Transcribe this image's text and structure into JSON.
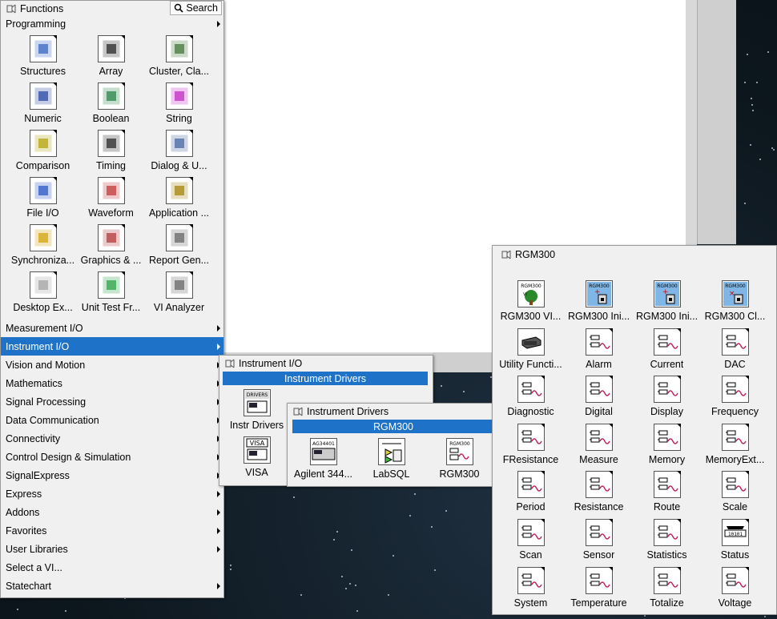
{
  "functions_palette": {
    "title": "Functions",
    "search_label": "Search",
    "category": "Programming",
    "icons": [
      {
        "label": "Structures",
        "icon": "structures-icon",
        "color": "#3060c0"
      },
      {
        "label": "Array",
        "icon": "array-icon",
        "color": "#202020"
      },
      {
        "label": "Cluster, Cla...",
        "icon": "cluster-icon",
        "color": "#3a7030"
      },
      {
        "label": "Numeric",
        "icon": "numeric-icon",
        "color": "#2040a0"
      },
      {
        "label": "Boolean",
        "icon": "boolean-icon",
        "color": "#208040"
      },
      {
        "label": "String",
        "icon": "string-icon",
        "color": "#c020c0"
      },
      {
        "label": "Comparison",
        "icon": "comparison-icon",
        "color": "#b0a000"
      },
      {
        "label": "Timing",
        "icon": "timing-icon",
        "color": "#202020"
      },
      {
        "label": "Dialog & U...",
        "icon": "dialog-icon",
        "color": "#4060a0"
      },
      {
        "label": "File I/O",
        "icon": "file-io-icon",
        "color": "#2050c0"
      },
      {
        "label": "Waveform",
        "icon": "waveform-icon",
        "color": "#c03030"
      },
      {
        "label": "Application ...",
        "icon": "application-icon",
        "color": "#a08000"
      },
      {
        "label": "Synchroniza...",
        "icon": "synchronization-icon",
        "color": "#d0a000"
      },
      {
        "label": "Graphics & ...",
        "icon": "graphics-icon",
        "color": "#b03030"
      },
      {
        "label": "Report Gen...",
        "icon": "report-icon",
        "color": "#606060"
      },
      {
        "label": "Desktop Ex...",
        "icon": "desktop-execution-icon",
        "color": "#a0a0a0"
      },
      {
        "label": "Unit Test Fr...",
        "icon": "unit-test-icon",
        "color": "#20a040"
      },
      {
        "label": "VI Analyzer",
        "icon": "vi-analyzer-icon",
        "color": "#606060"
      }
    ],
    "menu_items": [
      "Measurement I/O",
      "Instrument I/O",
      "Vision and Motion",
      "Mathematics",
      "Signal Processing",
      "Data Communication",
      "Connectivity",
      "Control Design & Simulation",
      "SignalExpress",
      "Express",
      "Addons",
      "Favorites",
      "User Libraries",
      "Select a VI...",
      "Statechart"
    ],
    "selected_menu": "Instrument I/O"
  },
  "instrument_io_palette": {
    "title": "Instrument I/O",
    "highlight": "Instrument Drivers",
    "icons": [
      {
        "label": "Instr Drivers",
        "icon": "instr-drivers-icon"
      },
      {
        "label": "VISA",
        "icon": "visa-icon"
      }
    ]
  },
  "instrument_drivers_palette": {
    "title": "Instrument Drivers",
    "highlight": "RGM300",
    "icons": [
      {
        "label": "Agilent 344...",
        "icon": "agilent-icon"
      },
      {
        "label": "LabSQL",
        "icon": "labsql-icon"
      },
      {
        "label": "RGM300",
        "icon": "rgm300-icon"
      }
    ]
  },
  "rgm300_palette": {
    "title": "RGM300",
    "icons": [
      {
        "label": "RGM300 VI...",
        "icon": "vi-tree-icon"
      },
      {
        "label": "RGM300 Ini...",
        "icon": "initialize-icon"
      },
      {
        "label": "RGM300 Ini...",
        "icon": "initialize-2-icon"
      },
      {
        "label": "RGM300 Cl...",
        "icon": "close-icon"
      },
      {
        "label": "Utility Functi...",
        "icon": "utility-icon"
      },
      {
        "label": "Alarm",
        "icon": "subpalette-icon"
      },
      {
        "label": "Current",
        "icon": "subpalette-icon"
      },
      {
        "label": "DAC",
        "icon": "subpalette-icon"
      },
      {
        "label": "Diagnostic",
        "icon": "subpalette-icon"
      },
      {
        "label": "Digital",
        "icon": "subpalette-icon"
      },
      {
        "label": "Display",
        "icon": "subpalette-icon"
      },
      {
        "label": "Frequency",
        "icon": "subpalette-icon"
      },
      {
        "label": "FResistance",
        "icon": "subpalette-icon"
      },
      {
        "label": "Measure",
        "icon": "subpalette-icon"
      },
      {
        "label": "Memory",
        "icon": "subpalette-icon"
      },
      {
        "label": "MemoryExt...",
        "icon": "subpalette-icon"
      },
      {
        "label": "Period",
        "icon": "subpalette-icon"
      },
      {
        "label": "Resistance",
        "icon": "subpalette-icon"
      },
      {
        "label": "Route",
        "icon": "subpalette-icon"
      },
      {
        "label": "Scale",
        "icon": "subpalette-icon"
      },
      {
        "label": "Scan",
        "icon": "subpalette-icon"
      },
      {
        "label": "Sensor",
        "icon": "subpalette-icon"
      },
      {
        "label": "Statistics",
        "icon": "subpalette-icon"
      },
      {
        "label": "Status",
        "icon": "status-icon"
      },
      {
        "label": "System",
        "icon": "subpalette-icon"
      },
      {
        "label": "Temperature",
        "icon": "subpalette-icon"
      },
      {
        "label": "Totalize",
        "icon": "subpalette-icon"
      },
      {
        "label": "Voltage",
        "icon": "subpalette-icon"
      }
    ]
  },
  "colors": {
    "selection": "#1e73c8",
    "palette_bg": "#f0f0f0"
  }
}
